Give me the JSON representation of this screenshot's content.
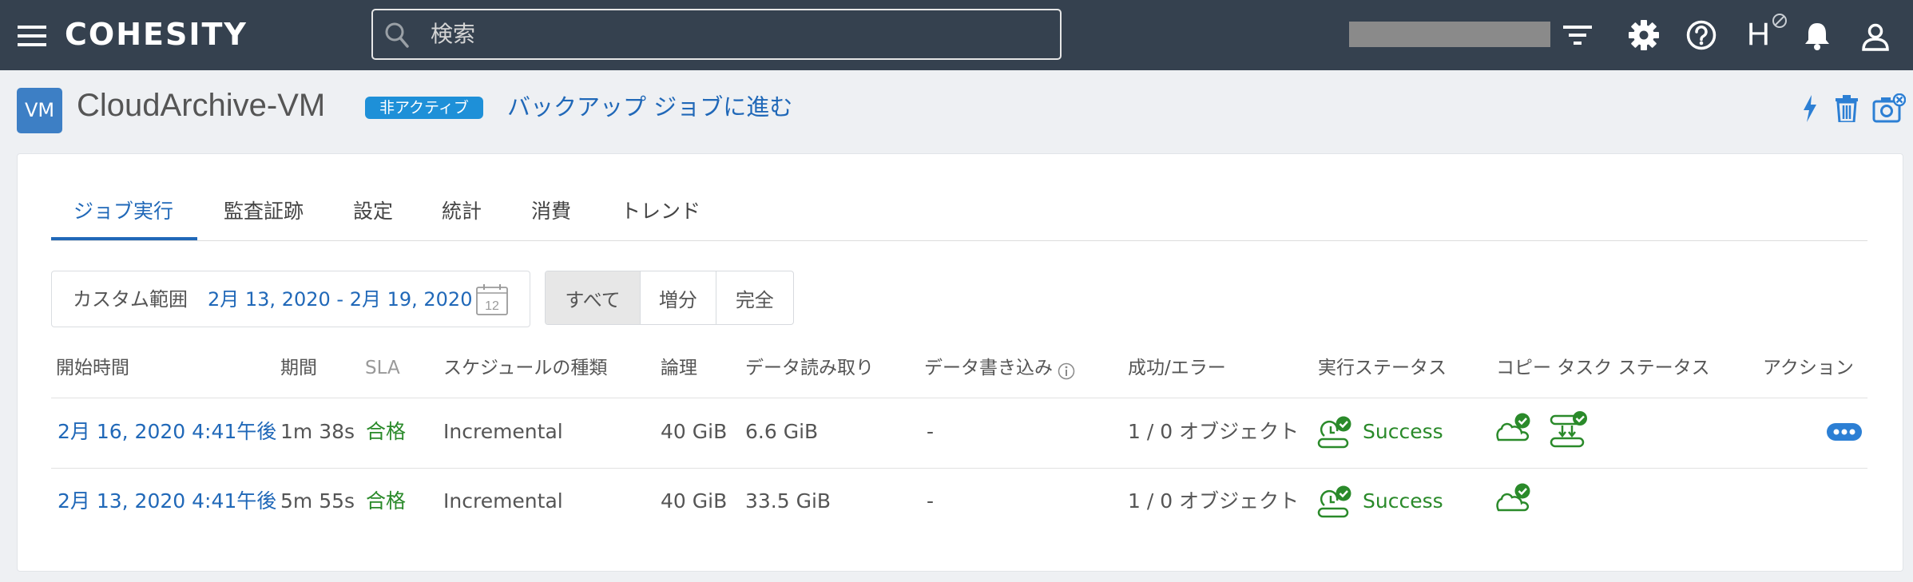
{
  "topbar": {
    "logo": "COHESITY",
    "search_placeholder": "検索",
    "user_initial": "H"
  },
  "header": {
    "avatar_text": "VM",
    "title": "CloudArchive-VM",
    "status_badge": "非アクティブ",
    "goto_link": "バックアップ ジョブに進む"
  },
  "tabs": [
    {
      "label": "ジョブ実行",
      "active": true
    },
    {
      "label": "監査証跡"
    },
    {
      "label": "設定"
    },
    {
      "label": "統計"
    },
    {
      "label": "消費"
    },
    {
      "label": "トレンド"
    }
  ],
  "filter": {
    "range_label": "カスタム範囲",
    "range_value": "2月 13, 2020 - 2月 19, 2020",
    "calendar_day": "12",
    "segments": [
      "すべて",
      "増分",
      "完全"
    ],
    "selected_segment": "すべて"
  },
  "table": {
    "headers": {
      "start": "開始時間",
      "duration": "期間",
      "sla": "SLA",
      "schedule": "スケジュールの種類",
      "logical": "論理",
      "read": "データ読み取り",
      "written": "データ書き込み",
      "result": "成功/エラー",
      "run_status": "実行ステータス",
      "copy_status": "コピー タスク ステータス",
      "action": "アクション"
    },
    "rows": [
      {
        "start": "2月 16, 2020 4:41午後",
        "duration": "1m 38s",
        "sla": "合格",
        "schedule": "Incremental",
        "logical": "40 GiB",
        "read": "6.6 GiB",
        "written": "-",
        "result": "1 / 0 オブジェクト",
        "status": "Success"
      },
      {
        "start": "2月 13, 2020 4:41午後",
        "duration": "5m 55s",
        "sla": "合格",
        "schedule": "Incremental",
        "logical": "40 GiB",
        "read": "33.5 GiB",
        "written": "-",
        "result": "1 / 0 オブジェクト",
        "status": "Success"
      }
    ]
  },
  "colors": {
    "topbar": "#35414f",
    "accent": "#2068b8",
    "success": "#2a8a2a",
    "badge": "#1e90d8"
  },
  "icons": [
    "menu-icon",
    "search-icon",
    "filter-icon",
    "gear-icon",
    "help-icon",
    "no-entry-icon",
    "bell-icon",
    "user-icon",
    "lightning-icon",
    "trash-icon",
    "camera-icon",
    "calendar-icon",
    "info-icon",
    "backup-success-icon",
    "cloud-success-icon",
    "replication-icon",
    "more-icon"
  ]
}
